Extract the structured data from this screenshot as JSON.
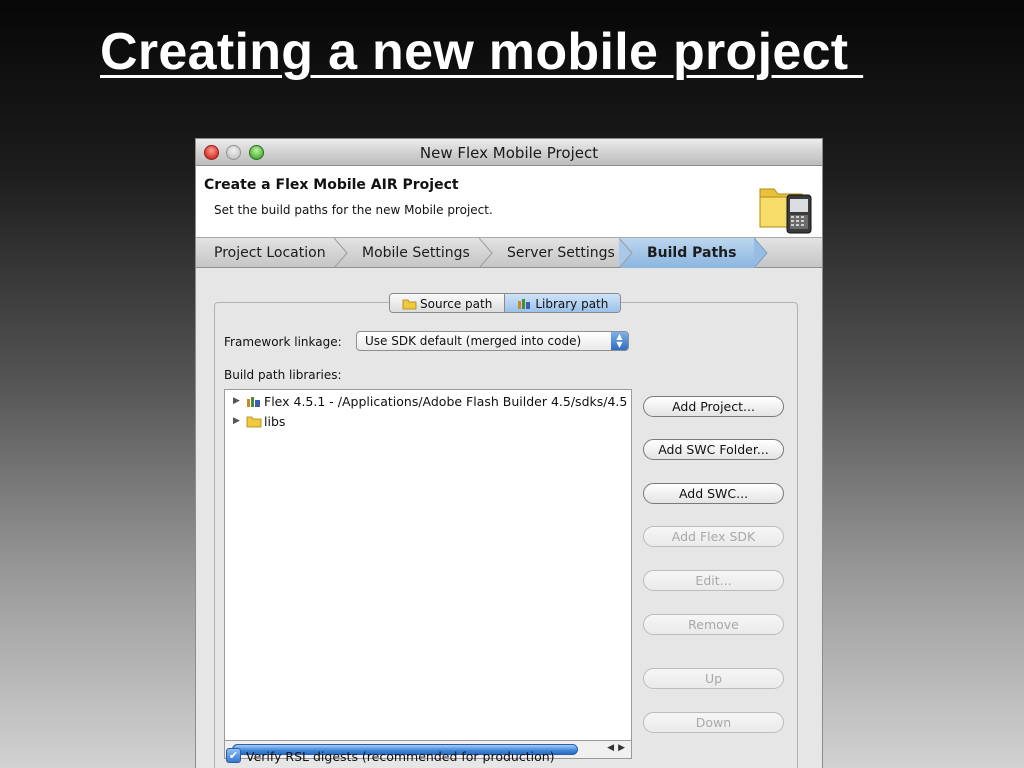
{
  "slide": {
    "title": "Creating a new mobile project "
  },
  "window": {
    "title": "New Flex Mobile Project"
  },
  "header": {
    "title": "Create a Flex Mobile AIR Project",
    "description": "Set the build paths for the new Mobile project."
  },
  "steps": [
    {
      "label": "Project Location"
    },
    {
      "label": "Mobile Settings"
    },
    {
      "label": "Server Settings"
    },
    {
      "label": "Build Paths"
    }
  ],
  "path_tabs": {
    "source": "Source path",
    "library": "Library path"
  },
  "framework": {
    "label": "Framework linkage:",
    "value": "Use SDK default (merged into code)"
  },
  "libraries": {
    "label": "Build path libraries:",
    "items": [
      {
        "label": "Flex 4.5.1 - /Applications/Adobe Flash Builder 4.5/sdks/4.5"
      },
      {
        "label": "libs"
      }
    ]
  },
  "buttons": {
    "add_project": "Add Project...",
    "add_swc_folder": "Add SWC Folder...",
    "add_swc": "Add SWC...",
    "add_flex_sdk": "Add Flex SDK",
    "edit": "Edit...",
    "remove": "Remove",
    "up": "Up",
    "down": "Down"
  },
  "verify_rsl": {
    "label": "Verify RSL digests (recommended for production)",
    "checked": true
  },
  "colors": {
    "active_step": "#8bb5e0",
    "accent_blue": "#3679d0"
  },
  "icons": [
    "folder-phone-icon",
    "folder-icon",
    "library-icon",
    "checkmark-icon"
  ]
}
